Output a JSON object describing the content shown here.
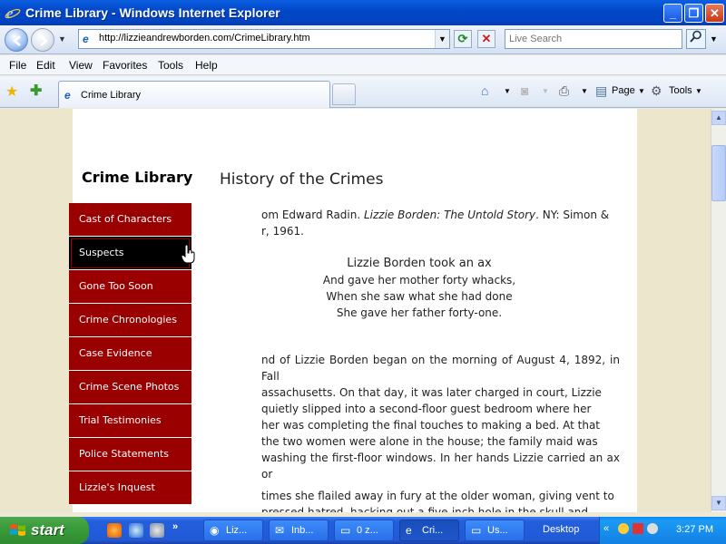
{
  "window": {
    "title": "Crime Library - Windows Internet Explorer",
    "minimize": "_",
    "maximize": "❐",
    "close": "✕"
  },
  "address": {
    "url": "http://lizzieandrewborden.com/CrimeLibrary.htm",
    "search_placeholder": "Live Search"
  },
  "menubar": {
    "items": [
      "File",
      "Edit",
      "View",
      "Favorites",
      "Tools",
      "Help"
    ]
  },
  "tabs": {
    "active_label": "Crime Library"
  },
  "commandbar": {
    "page_label": "Page",
    "tools_label": "Tools"
  },
  "page": {
    "heading": "Crime Library",
    "title": "History of the Crimes",
    "from_text_visible": "om Edward Radin. ",
    "from_book": "Lizzie Borden: The Untold Story",
    "from_tail": ". NY: Simon &",
    "from_line2": "r, 1961.",
    "poem": [
      "Lizzie Borden took an ax",
      "And gave her mother forty whacks,",
      "When she saw what she had done",
      "She gave her father forty-one."
    ],
    "para1_lines": [
      "nd of Lizzie Borden began on the morning of August 4, 1892, in Fall",
      "assachusetts. On that day, it was later charged in court, Lizzie",
      "quietly slipped into a second-floor guest bedroom where her",
      "her was completing the final touches to making a bed. At that",
      "the two women were alone in the house; the family maid was",
      "washing the first-floor windows. In her hands Lizzie carried an ax or"
    ],
    "para2_lines": [
      "times she flailed away in fury at the older woman, giving vent to",
      "pressed hatred, hacking out a five-inch hole in the skull and"
    ]
  },
  "navmenu": {
    "items": [
      "Cast of Characters",
      "Suspects",
      "Gone Too Soon",
      "Crime Chronologies",
      "Case Evidence",
      "Crime Scene Photos",
      "Trial Testimonies",
      "Police Statements",
      "Lizzie's Inquest"
    ],
    "active_index": 1
  },
  "taskbar": {
    "start_label": "start",
    "buttons": [
      "Liz...",
      "Inb...",
      "0 z...",
      "Cri...",
      "Us..."
    ],
    "active_index": 3,
    "desktop_label": "Desktop",
    "clock": "3:27 PM"
  },
  "colors": {
    "nav_red": "#9b0000",
    "nav_active": "#000000",
    "page_margin": "#ece6cc"
  }
}
